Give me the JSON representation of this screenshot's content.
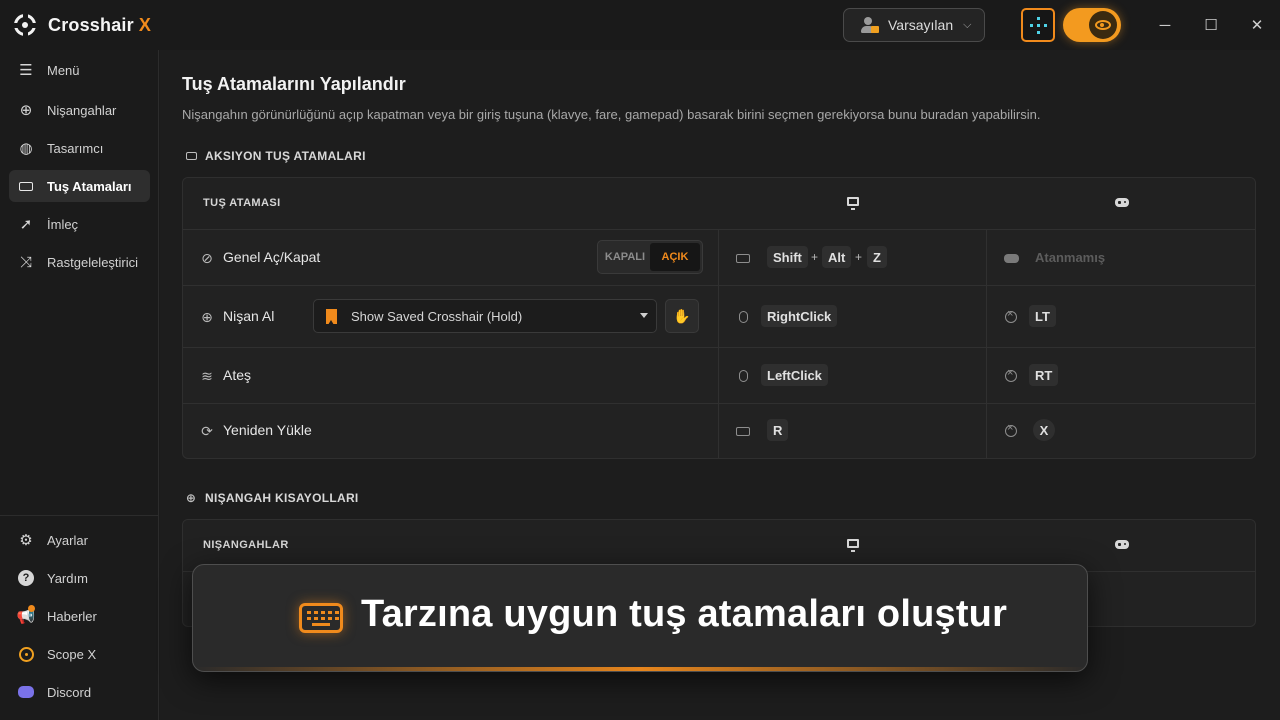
{
  "app": {
    "brand": "Crosshair",
    "brand_suffix": "X"
  },
  "titlebar": {
    "profile_label": "Varsayılan",
    "minimize_icon": "minimize-icon",
    "maximize_icon": "maximize-icon",
    "close_icon": "close-icon",
    "toggle_state": "on"
  },
  "sidebar": {
    "items": [
      {
        "label": "Menü",
        "icon": "hamburger-icon"
      },
      {
        "label": "Nişangahlar",
        "icon": "crosshair-icon"
      },
      {
        "label": "Tasarımcı",
        "icon": "palette-icon"
      },
      {
        "label": "Tuş Atamaları",
        "icon": "keyboard-icon",
        "active": true
      },
      {
        "label": "İmleç",
        "icon": "cursor-icon"
      },
      {
        "label": "Rastgeleleştirici",
        "icon": "shuffle-icon"
      }
    ],
    "bottom_items": [
      {
        "label": "Ayarlar",
        "icon": "gear-icon"
      },
      {
        "label": "Yardım",
        "icon": "help-icon"
      },
      {
        "label": "Haberler",
        "icon": "megaphone-icon"
      },
      {
        "label": "Scope X",
        "icon": "scope-icon"
      },
      {
        "label": "Discord",
        "icon": "discord-icon"
      }
    ]
  },
  "main": {
    "title": "Tuş Atamalarını Yapılandır",
    "subtitle": "Nişangahın görünürlüğünü açıp kapatman veya bir giriş tuşuna (klavye, fare, gamepad) basarak birini seçmen gerekiyorsa bunu buradan yapabilirsin.",
    "action_section": {
      "heading": "AKSIYON TUŞ ATAMALARI",
      "column_header": "TUŞ ATAMASI",
      "rows": [
        {
          "label": "Genel Aç/Kapat",
          "icon": "eye-off-icon",
          "toggle_off": "KAPALI",
          "toggle_on": "AÇIK",
          "pc_keys": [
            "Shift",
            "Alt",
            "Z"
          ],
          "pad_value": "Atanmamış"
        },
        {
          "label": "Nişan Al",
          "icon": "crosshair-icon",
          "select_value": "Show Saved Crosshair (Hold)",
          "pc_keys": [
            "RightClick"
          ],
          "pad_keys": [
            "LT"
          ]
        },
        {
          "label": "Ateş",
          "icon": "fire-icon",
          "pc_keys": [
            "LeftClick"
          ],
          "pad_keys": [
            "RT"
          ]
        },
        {
          "label": "Yeniden Yükle",
          "icon": "reload-icon",
          "pc_keys": [
            "R"
          ],
          "pad_keys": [
            "X"
          ]
        }
      ]
    },
    "crosshair_section": {
      "heading": "NIŞANGAH KISAYOLLARI",
      "column_header": "NIŞANGAHLAR"
    }
  },
  "banner": {
    "text": "Tarzına uygun tuş atamaları oluştur",
    "icon": "keyboard-icon"
  },
  "colors": {
    "accent": "#f08a1c",
    "cyan": "#4fd2e6",
    "background": "#1d1d1d"
  }
}
